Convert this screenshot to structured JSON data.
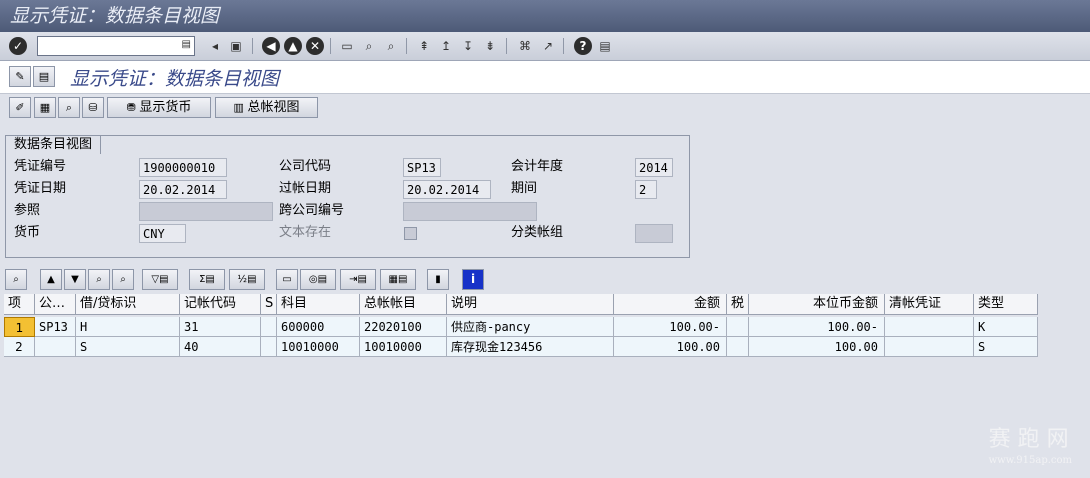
{
  "window": {
    "title": "显示凭证：数据条目视图"
  },
  "app": {
    "title": "显示凭证：数据条目视图"
  },
  "appbar": {
    "display_currency": "显示货币",
    "general_ledger_view": "总帐视图"
  },
  "header": {
    "tab": "数据条目视图",
    "doc_number_label": "凭证编号",
    "doc_number": "1900000010",
    "company_code_label": "公司代码",
    "company_code": "SP13",
    "fiscal_year_label": "会计年度",
    "fiscal_year": "2014",
    "doc_date_label": "凭证日期",
    "doc_date": "20.02.2014",
    "posting_date_label": "过帐日期",
    "posting_date": "20.02.2014",
    "period_label": "期间",
    "period": "2",
    "reference_label": "参照",
    "reference": "",
    "cross_company_label": "跨公司编号",
    "cross_company": "",
    "currency_label": "货币",
    "currency": "CNY",
    "text_exists_label": "文本存在",
    "ledger_group_label": "分类帐组",
    "ledger_group": ""
  },
  "table": {
    "columns": [
      "项",
      "公…",
      "借/贷标识",
      "记帐代码",
      "S",
      "科目",
      "总帐帐目",
      "说明",
      "金额",
      "税",
      "本位币金额",
      "清帐凭证",
      "类型"
    ],
    "rows": [
      [
        "1",
        "SP13",
        "H",
        "31",
        "",
        "600000",
        "22020100",
        "供应商-pancy",
        "100.00-",
        "",
        "100.00-",
        "",
        "K"
      ],
      [
        "2",
        "",
        "S",
        "40",
        "",
        "10010000",
        "10010000",
        "库存现金123456",
        "100.00",
        "",
        "100.00",
        "",
        "S"
      ]
    ]
  },
  "watermark": {
    "brand": "赛 跑 网",
    "url": "www.915ap.com"
  }
}
